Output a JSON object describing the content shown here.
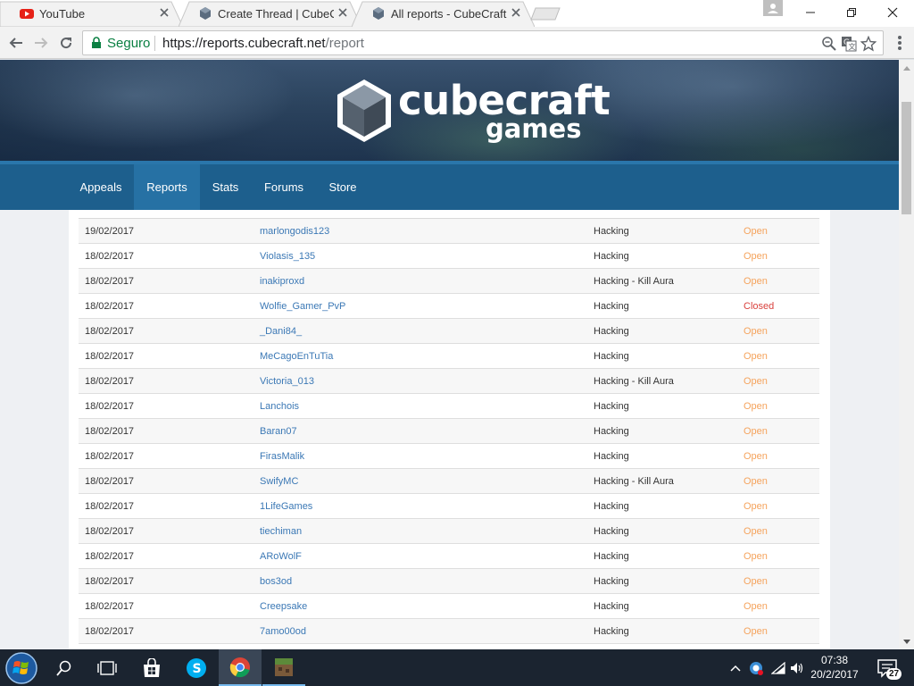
{
  "browser": {
    "tabs": [
      {
        "title": "YouTube",
        "favicon": "youtube-icon",
        "active": false
      },
      {
        "title": "Create Thread | CubeCraf",
        "favicon": "cubecraft-icon",
        "active": false
      },
      {
        "title": "All reports - CubeCraft G",
        "favicon": "cubecraft-icon",
        "active": true
      }
    ],
    "address": {
      "secure_label": "Seguro",
      "url_host": "https://reports.cubecraft.net",
      "url_path": "/report"
    }
  },
  "site": {
    "logo_word": "cubecraft",
    "logo_sub": "games",
    "nav": [
      {
        "label": "Appeals",
        "active": false
      },
      {
        "label": "Reports",
        "active": true
      },
      {
        "label": "Stats",
        "active": false
      },
      {
        "label": "Forums",
        "active": false
      },
      {
        "label": "Store",
        "active": false
      }
    ]
  },
  "reports": {
    "rows": [
      {
        "date": "19/02/2017",
        "player": "marlongodis123",
        "type": "Hacking",
        "status": "Open"
      },
      {
        "date": "18/02/2017",
        "player": "Violasis_135",
        "type": "Hacking",
        "status": "Open"
      },
      {
        "date": "18/02/2017",
        "player": "inakiproxd",
        "type": "Hacking - Kill Aura",
        "status": "Open"
      },
      {
        "date": "18/02/2017",
        "player": "Wolfie_Gamer_PvP",
        "type": "Hacking",
        "status": "Closed"
      },
      {
        "date": "18/02/2017",
        "player": "_Dani84_",
        "type": "Hacking",
        "status": "Open"
      },
      {
        "date": "18/02/2017",
        "player": "MeCagoEnTuTia",
        "type": "Hacking",
        "status": "Open"
      },
      {
        "date": "18/02/2017",
        "player": "Victoria_013",
        "type": "Hacking - Kill Aura",
        "status": "Open"
      },
      {
        "date": "18/02/2017",
        "player": "Lanchois",
        "type": "Hacking",
        "status": "Open"
      },
      {
        "date": "18/02/2017",
        "player": "Baran07",
        "type": "Hacking",
        "status": "Open"
      },
      {
        "date": "18/02/2017",
        "player": "FirasMalik",
        "type": "Hacking",
        "status": "Open"
      },
      {
        "date": "18/02/2017",
        "player": "SwifyMC",
        "type": "Hacking - Kill Aura",
        "status": "Open"
      },
      {
        "date": "18/02/2017",
        "player": "1LifeGames",
        "type": "Hacking",
        "status": "Open"
      },
      {
        "date": "18/02/2017",
        "player": "tiechiman",
        "type": "Hacking",
        "status": "Open"
      },
      {
        "date": "18/02/2017",
        "player": "ARoWolF",
        "type": "Hacking",
        "status": "Open"
      },
      {
        "date": "18/02/2017",
        "player": "bos3od",
        "type": "Hacking",
        "status": "Open"
      },
      {
        "date": "18/02/2017",
        "player": "Creepsake",
        "type": "Hacking",
        "status": "Open"
      },
      {
        "date": "18/02/2017",
        "player": "7amo00od",
        "type": "Hacking",
        "status": "Open"
      }
    ],
    "status_colors": {
      "Open": "#f5a35c",
      "Closed": "#d9413d"
    }
  },
  "taskbar": {
    "apps": [
      "start-button",
      "search-icon",
      "task-view-icon",
      "store-icon",
      "skype-icon",
      "chrome-icon",
      "minecraft-icon"
    ],
    "clock_time": "07:38",
    "clock_date": "20/2/2017",
    "notification_count": "27"
  }
}
